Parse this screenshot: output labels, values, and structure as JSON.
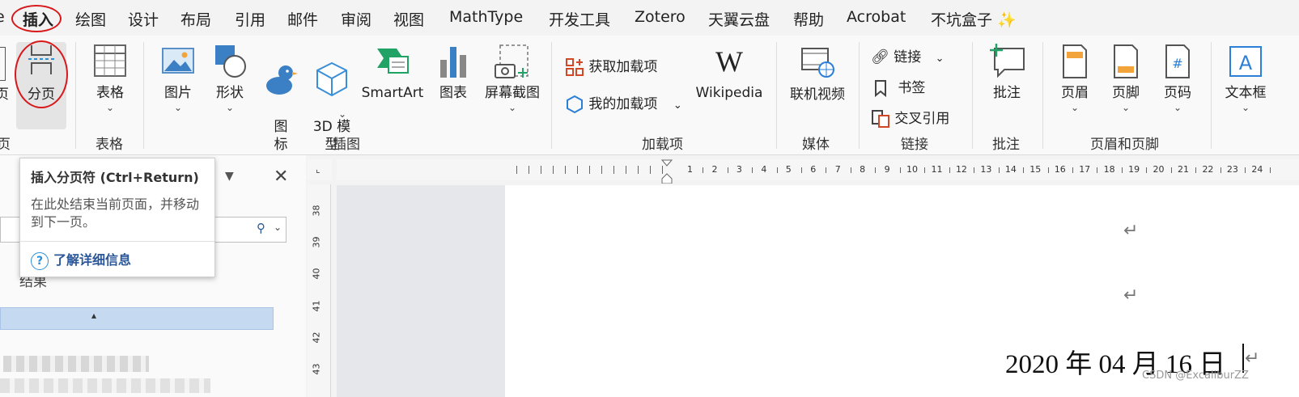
{
  "tabs": [
    "插入",
    "绘图",
    "设计",
    "布局",
    "引用",
    "邮件",
    "审阅",
    "视图",
    "MathType",
    "开发工具",
    "Zotero",
    "天翼云盘",
    "帮助",
    "Acrobat",
    "不坑盒子 ✨"
  ],
  "active_tab": "插入",
  "ribbon": {
    "partial_left_label": "页",
    "page_break": "分页",
    "table": "表格",
    "picture": "图片",
    "shapes": "形状",
    "icons": "图\n标",
    "model3d": "3D 模\n型",
    "smartart": "SmartArt",
    "chart": "图表",
    "screenshot": "屏幕截图",
    "get_addins": "获取加载项",
    "my_addins": "我的加载项",
    "wikipedia": "Wikipedia",
    "online_video": "联机视频",
    "link": "链接",
    "bookmark": "书签",
    "cross_ref": "交叉引用",
    "comment": "批注",
    "header": "页眉",
    "footer": "页脚",
    "page_number": "页码",
    "textbox": "文本框",
    "groups": {
      "pages_partial": "页",
      "tables": "表格",
      "illustrations": "插图",
      "addins": "加载项",
      "media": "媒体",
      "links": "链接",
      "comments": "批注",
      "header_footer": "页眉和页脚"
    }
  },
  "tooltip": {
    "title": "插入分页符 (Ctrl+Return)",
    "body": "在此处结束当前页面，并移动到下一页。",
    "link": "了解详细信息"
  },
  "left_pane": {
    "result_text": "结果"
  },
  "ruler": {
    "h_numbers": [
      "1",
      "2",
      "3",
      "4",
      "5",
      "6",
      "7",
      "8",
      "9",
      "10",
      "11",
      "12",
      "13",
      "14",
      "15",
      "16",
      "17",
      "18",
      "19",
      "20",
      "21",
      "22",
      "23",
      "24"
    ],
    "v_numbers": [
      "38",
      "39",
      "40",
      "41",
      "42",
      "43"
    ]
  },
  "document": {
    "date_line": "2020 年 04 月 16 日",
    "return_mark": "↵"
  },
  "watermark": "CSDN @ExcaliburZZ",
  "colors": {
    "accent": "#2b579a",
    "annotation": "#d7191c"
  }
}
